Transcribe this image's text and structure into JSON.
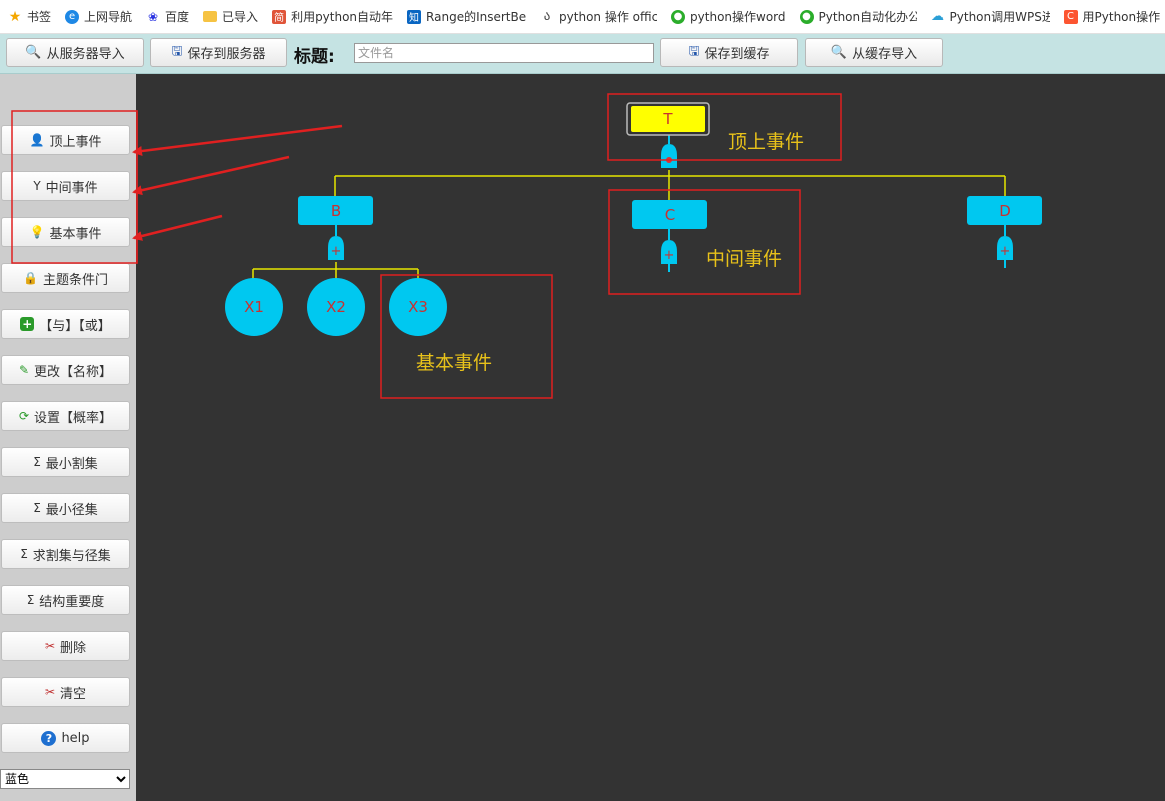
{
  "bookmarks": [
    {
      "label": "书签",
      "icon": "star-icon",
      "color": "#f4a700"
    },
    {
      "label": "上网导航",
      "icon": "browser-e-icon",
      "color": "#1e88e5"
    },
    {
      "label": "百度",
      "icon": "baidu-paw-icon",
      "color": "#2932e1"
    },
    {
      "label": "已导入",
      "icon": "folder-icon",
      "color": "#f6c343"
    },
    {
      "label": "利用python自动年",
      "icon": "jian-icon",
      "color": "#e0553a"
    },
    {
      "label": "Range的InsertBe",
      "icon": "zhihu-icon",
      "color": "#0a66c2"
    },
    {
      "label": "python 操作 offic",
      "icon": "script-icon",
      "color": "#444444"
    },
    {
      "label": "python操作word",
      "icon": "wechat-icon",
      "color": "#2bad2b"
    },
    {
      "label": "Python自动化办公",
      "icon": "wechat-icon",
      "color": "#2bad2b"
    },
    {
      "label": "Python调用WPS进",
      "icon": "cloud-icon",
      "color": "#2a9fd6"
    },
    {
      "label": "用Python操作",
      "icon": "csdn-icon",
      "color": "#fc5531"
    }
  ],
  "toolbar": {
    "import_server": "从服务器导入",
    "save_server": "保存到服务器",
    "title_label": "标题:",
    "filename_placeholder": "文件名",
    "filename_value": "",
    "save_cache": "保存到缓存",
    "import_cache": "从缓存导入"
  },
  "sidebar": {
    "buttons": [
      {
        "label": "顶上事件",
        "icon": "user-icon"
      },
      {
        "label": "中间事件",
        "icon": "branch-icon"
      },
      {
        "label": "基本事件",
        "icon": "bulb-icon"
      },
      {
        "label": "主题条件门",
        "icon": "lock-icon"
      },
      {
        "label": "【与】【或】",
        "icon": "plus-icon"
      },
      {
        "label": "更改【名称】",
        "icon": "pencil-icon"
      },
      {
        "label": "设置【概率】",
        "icon": "refresh-icon"
      },
      {
        "label": "最小割集",
        "icon": "sigma-icon"
      },
      {
        "label": "最小径集",
        "icon": "sigma-icon"
      },
      {
        "label": "求割集与径集",
        "icon": "sigma-icon"
      },
      {
        "label": "结构重要度",
        "icon": "sigma-icon"
      },
      {
        "label": "删除",
        "icon": "scissors-icon"
      },
      {
        "label": "清空",
        "icon": "scissors-icon"
      },
      {
        "label": "help",
        "icon": "help-icon"
      }
    ],
    "theme_select": "蓝色"
  },
  "tree": {
    "top_event": "T",
    "intermediate_events": [
      "B",
      "C",
      "D"
    ],
    "basic_events": [
      "X1",
      "X2",
      "X3"
    ],
    "gate_symbol": "+",
    "annotations": {
      "top": "顶上事件",
      "intermediate": "中间事件",
      "basic": "基本事件"
    }
  },
  "colors": {
    "canvas_bg": "#333333",
    "node_fill": "#00c8f0",
    "node_text": "#c83232",
    "top_fill": "#ffff00",
    "connector": "#e6e600",
    "annotation_box": "#e02020",
    "annotation_text": "#e8c21a"
  }
}
